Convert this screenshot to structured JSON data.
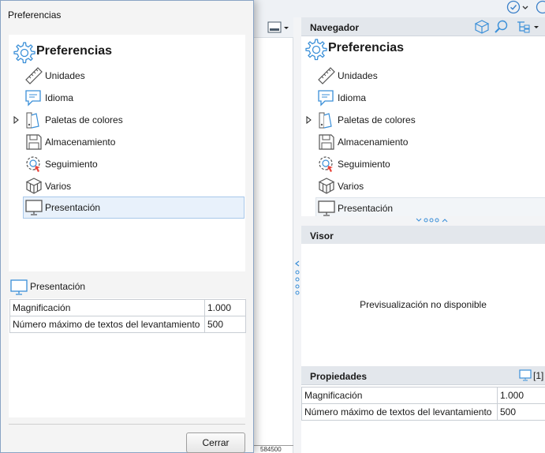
{
  "dialog": {
    "title": "Preferencias",
    "close_label": "Cerrar"
  },
  "tree": {
    "root": "Preferencias",
    "items": [
      {
        "label": "Unidades",
        "icon": "ruler-icon"
      },
      {
        "label": "Idioma",
        "icon": "chat-bubble-icon"
      },
      {
        "label": "Paletas de colores",
        "icon": "color-palette-icon"
      },
      {
        "label": "Almacenamiento",
        "icon": "floppy-disk-icon"
      },
      {
        "label": "Seguimiento",
        "icon": "tracking-target-icon"
      },
      {
        "label": "Varios",
        "icon": "cubes-icon"
      },
      {
        "label": "Presentación",
        "icon": "monitor-icon"
      }
    ],
    "selected": "Presentación"
  },
  "section": {
    "title": "Presentación"
  },
  "properties": [
    {
      "name": "Magnificación",
      "value": "1.000"
    },
    {
      "name": "Número máximo de textos del levantamiento",
      "value": "500"
    }
  ],
  "navigator": {
    "title": "Navegador"
  },
  "visor": {
    "title": "Visor",
    "message": "Previsualización no disponible"
  },
  "propiedades": {
    "title": "Propiedades",
    "badge": "[1]"
  },
  "ruler": {
    "label": "584500"
  },
  "colors": {
    "accent": "#3a8fd8",
    "selection": "#e8f1fb",
    "header": "#e3e7ec"
  }
}
